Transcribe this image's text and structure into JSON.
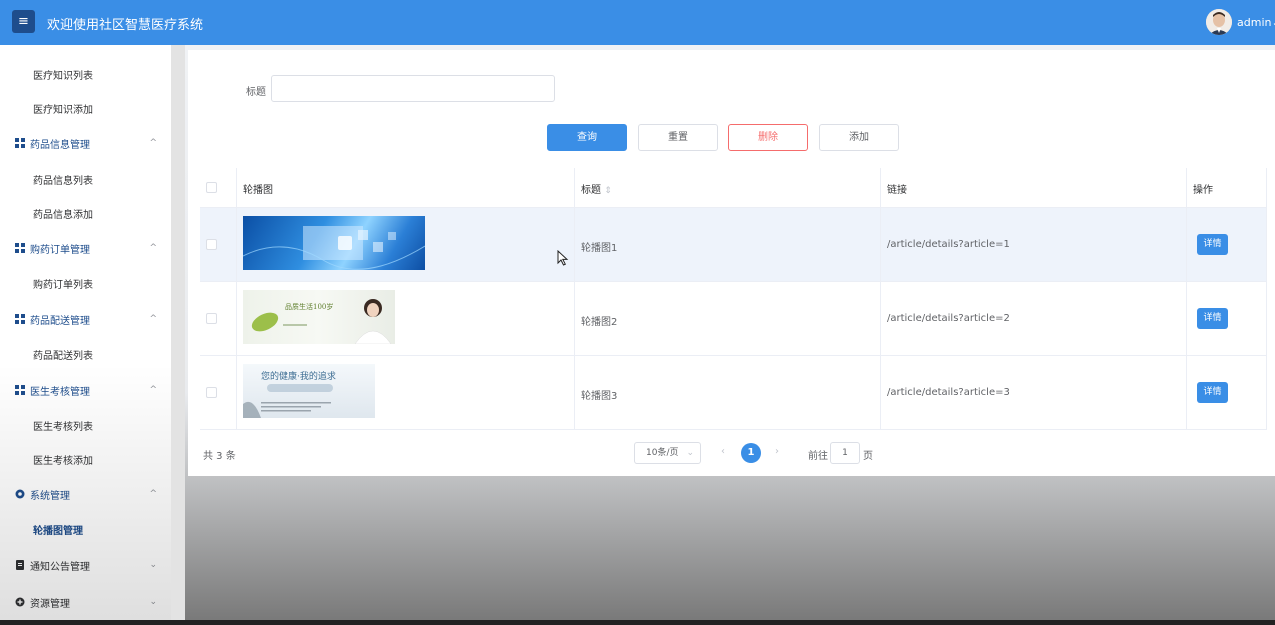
{
  "header": {
    "menu_icon": "menu-icon",
    "title": "欢迎使用社区智慧医疗系统",
    "user": "admin",
    "user_caret": "⌄"
  },
  "sidebar": {
    "items": [
      {
        "label": "医疗知识列表",
        "type": "sub"
      },
      {
        "label": "医疗知识添加",
        "type": "sub"
      },
      {
        "label": "药品信息管理",
        "type": "group",
        "caret": "^"
      },
      {
        "label": "药品信息列表",
        "type": "sub"
      },
      {
        "label": "药品信息添加",
        "type": "sub"
      },
      {
        "label": "购药订单管理",
        "type": "group",
        "caret": "^"
      },
      {
        "label": "购药订单列表",
        "type": "sub"
      },
      {
        "label": "药品配送管理",
        "type": "group",
        "caret": "^"
      },
      {
        "label": "药品配送列表",
        "type": "sub"
      },
      {
        "label": "医生考核管理",
        "type": "group",
        "caret": "^"
      },
      {
        "label": "医生考核列表",
        "type": "sub"
      },
      {
        "label": "医生考核添加",
        "type": "sub"
      },
      {
        "label": "系统管理",
        "type": "group",
        "caret": "^"
      },
      {
        "label": "轮播图管理",
        "type": "sub",
        "active": true
      },
      {
        "label": "通知公告管理",
        "type": "group",
        "caret": "⌄"
      },
      {
        "label": "资源管理",
        "type": "group",
        "caret": "⌄"
      }
    ]
  },
  "search": {
    "label": "标题",
    "value": ""
  },
  "buttons": {
    "query": "查询",
    "reset": "重置",
    "delete": "删除",
    "add": "添加"
  },
  "table": {
    "headers": {
      "image": "轮播图",
      "title": "标题",
      "sort_icon": "⇕",
      "link": "链接",
      "action": "操作"
    },
    "rows": [
      {
        "title": "轮播图1",
        "link": "/article/details?article=1",
        "action": "详情"
      },
      {
        "title": "轮播图2",
        "link": "/article/details?article=2",
        "action": "详情"
      },
      {
        "title": "轮播图3",
        "link": "/article/details?article=3",
        "action": "详情"
      }
    ],
    "banner2_text": "品质生活100岁",
    "banner3_text": "您的健康·我的追求"
  },
  "pager": {
    "total": "共 3 条",
    "page_size": "10条/页",
    "prev": "‹",
    "current": "1",
    "next": "›",
    "goto_label": "前往",
    "goto_value": "1",
    "page_suffix": "页"
  },
  "colors": {
    "primary": "#3a8ee6",
    "danger": "#f56c6c",
    "sidebar_accent": "#1e4d8c"
  }
}
